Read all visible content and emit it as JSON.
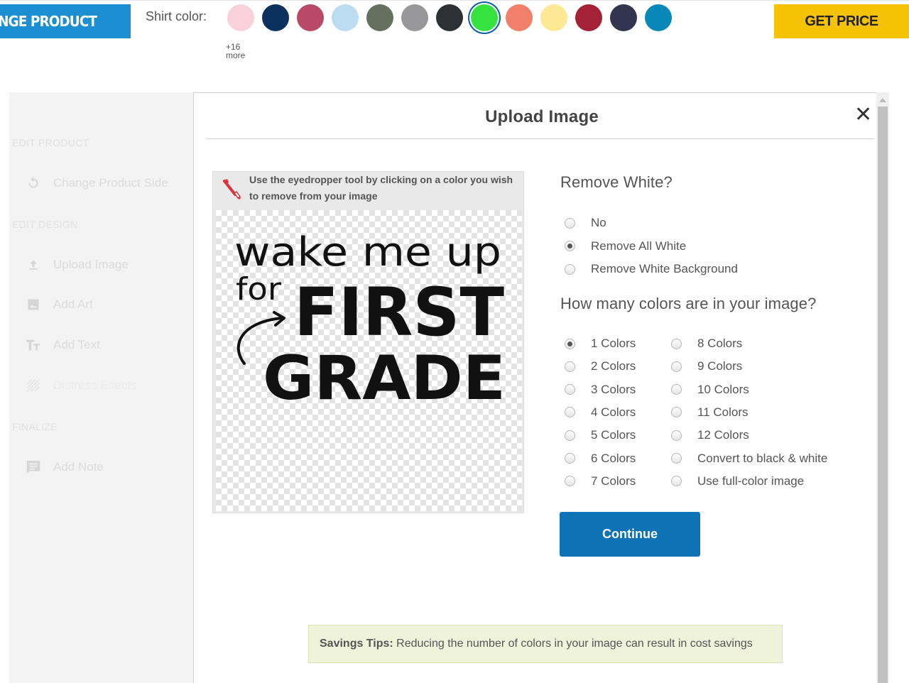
{
  "topbar": {
    "change_product_label": "HANGE PRODUCT",
    "shirt_color_label": "Shirt color:",
    "more_count": "+16",
    "more_label": "more",
    "get_price_label": "GET PRICE",
    "swatches": [
      {
        "name": "light-pink",
        "color": "#f9d1db"
      },
      {
        "name": "navy",
        "color": "#0c315e"
      },
      {
        "name": "heather-berry",
        "color": "#b84a68"
      },
      {
        "name": "light-blue",
        "color": "#bcdcf2"
      },
      {
        "name": "military-green",
        "color": "#66705f"
      },
      {
        "name": "gray",
        "color": "#98979a"
      },
      {
        "name": "charcoal",
        "color": "#2e3133"
      },
      {
        "name": "lime-green",
        "color": "#36e23f",
        "selected": true
      },
      {
        "name": "salmon",
        "color": "#f0806a"
      },
      {
        "name": "light-yellow",
        "color": "#fde994"
      },
      {
        "name": "cardinal-red",
        "color": "#a42136"
      },
      {
        "name": "midnight-navy",
        "color": "#33344f"
      },
      {
        "name": "teal-blue",
        "color": "#0788b8"
      }
    ]
  },
  "sidebar": {
    "sections": [
      {
        "label": "EDIT PRODUCT",
        "items": [
          {
            "label": "Change Product Side",
            "icon": "rotate-icon"
          }
        ]
      },
      {
        "label": "EDIT DESIGN",
        "items": [
          {
            "label": "Upload Image",
            "icon": "upload-icon"
          },
          {
            "label": "Add Art",
            "icon": "image-icon"
          },
          {
            "label": "Add Text",
            "icon": "text-icon"
          },
          {
            "label": "Distress Effects",
            "icon": "distress-icon"
          }
        ]
      },
      {
        "label": "FINALIZE",
        "items": [
          {
            "label": "Add Note",
            "icon": "note-icon"
          }
        ]
      }
    ]
  },
  "modal": {
    "title": "Upload Image",
    "close_glyph": "✕",
    "eyedropper_hint": "Use the eyedropper tool by clicking on a color you wish to remove from your image",
    "artwork": {
      "line1": "wake me up",
      "line2": "for",
      "line3": "FIRST",
      "line4": "GRADE"
    },
    "remove_white": {
      "heading": "Remove White?",
      "options": [
        {
          "label": "No",
          "checked": false
        },
        {
          "label": "Remove All White",
          "checked": true
        },
        {
          "label": "Remove White Background",
          "checked": false
        }
      ]
    },
    "colors": {
      "heading": "How many colors are in your image?",
      "left_options": [
        {
          "label": "1 Colors",
          "checked": true
        },
        {
          "label": "2 Colors",
          "checked": false
        },
        {
          "label": "3 Colors",
          "checked": false
        },
        {
          "label": "4 Colors",
          "checked": false
        },
        {
          "label": "5 Colors",
          "checked": false
        },
        {
          "label": "6 Colors",
          "checked": false
        },
        {
          "label": "7 Colors",
          "checked": false
        }
      ],
      "right_options": [
        {
          "label": "8 Colors",
          "checked": false
        },
        {
          "label": "9 Colors",
          "checked": false
        },
        {
          "label": "10 Colors",
          "checked": false
        },
        {
          "label": "11 Colors",
          "checked": false
        },
        {
          "label": "12 Colors",
          "checked": false
        },
        {
          "label": "Convert to black & white",
          "checked": false
        },
        {
          "label": "Use full-color image",
          "checked": false
        }
      ]
    },
    "continue_label": "Continue",
    "tips": {
      "prefix": "Savings Tips:",
      "text": " Reducing the number of colors in your image can result in cost savings"
    }
  },
  "colors": {
    "primary_blue": "#0e72b6",
    "top_blue": "#1b8fd2",
    "price_yellow": "#f6c204",
    "tips_bg": "#eef3da"
  }
}
